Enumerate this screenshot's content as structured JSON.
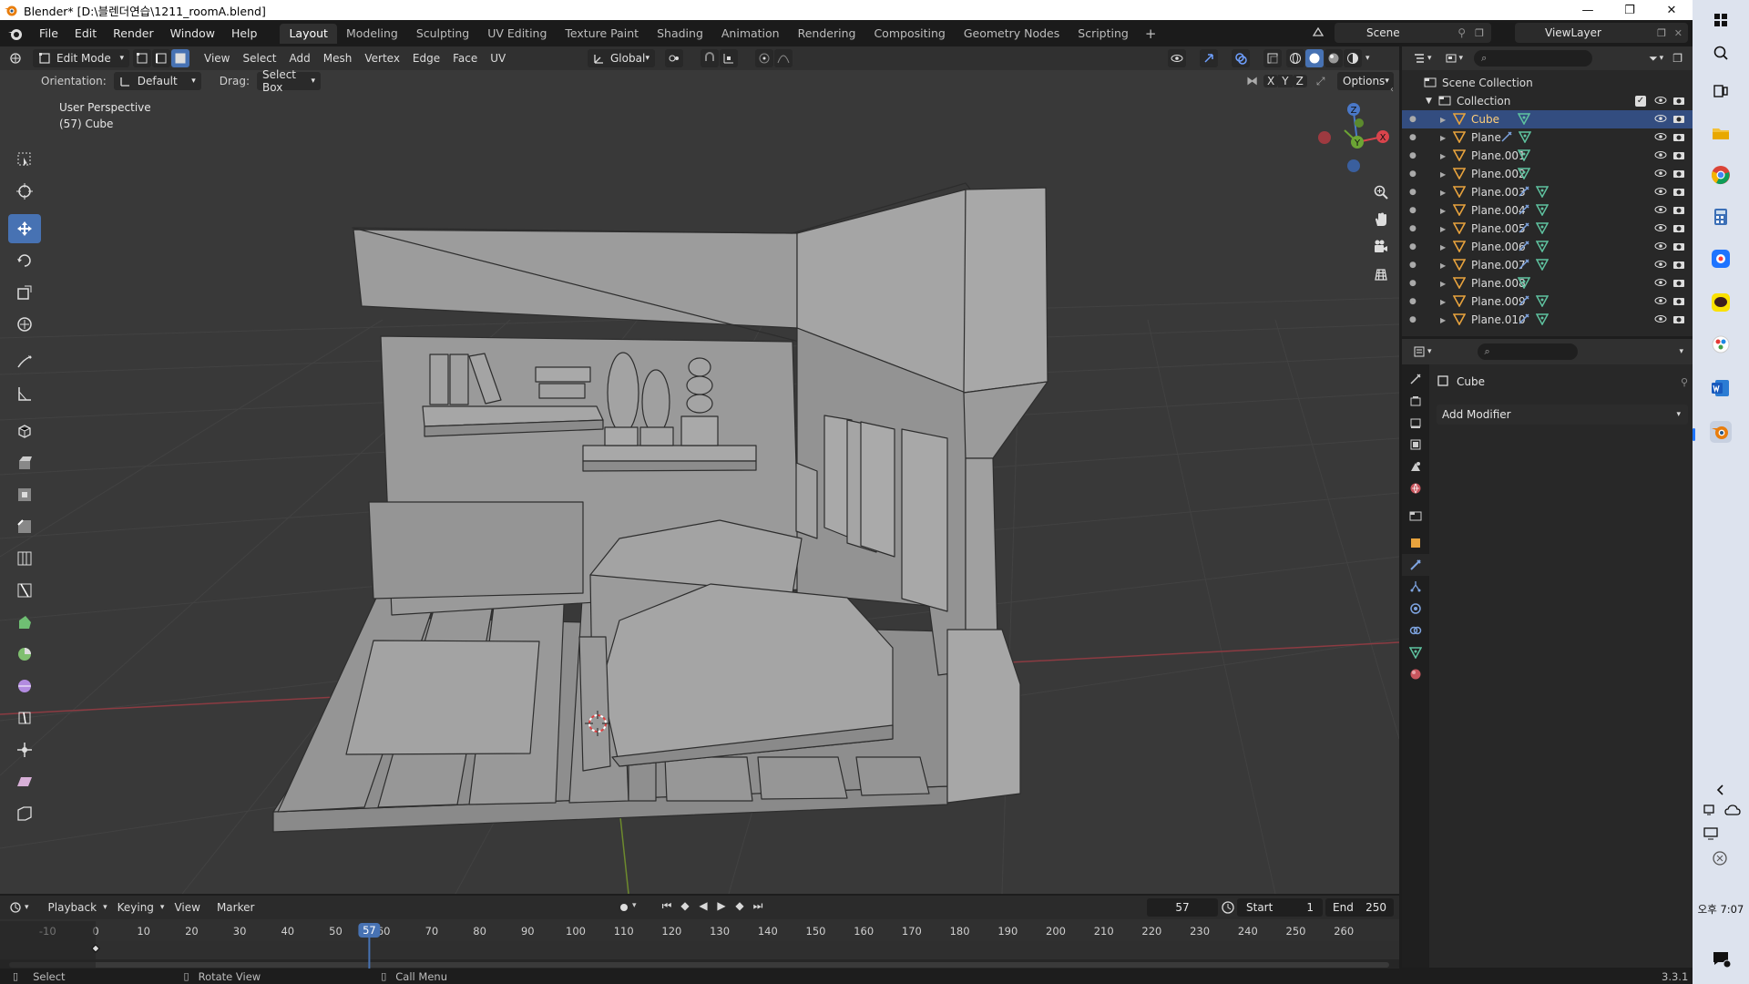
{
  "window": {
    "title": "Blender* [D:\\블렌더연습\\1211_roomA.blend]",
    "minimize": "—",
    "maximize": "❐",
    "close": "✕"
  },
  "menu": [
    "File",
    "Edit",
    "Render",
    "Window",
    "Help"
  ],
  "workspaces": [
    "Layout",
    "Modeling",
    "Sculpting",
    "UV Editing",
    "Texture Paint",
    "Shading",
    "Animation",
    "Rendering",
    "Compositing",
    "Geometry Nodes",
    "Scripting"
  ],
  "workspace_add": "+",
  "scene": {
    "name": "Scene",
    "view_layer": "ViewLayer"
  },
  "viewport": {
    "mode": "Edit Mode",
    "menus": [
      "View",
      "Select",
      "Add",
      "Mesh",
      "Vertex",
      "Edge",
      "Face",
      "UV"
    ],
    "transform_orientation": "Global",
    "orientation_label": "Orientation:",
    "orientation_value": "Default",
    "drag_label": "Drag:",
    "drag_value": "Select Box",
    "axes": [
      "X",
      "Y",
      "Z"
    ],
    "options": "Options",
    "info_line1": "User Perspective",
    "info_line2": "(57) Cube",
    "gizmo": {
      "x": "X",
      "y": "Y",
      "z": "Z"
    }
  },
  "timeline": {
    "menus": [
      "Playback",
      "Keying",
      "View",
      "Marker"
    ],
    "current_frame": "57",
    "start_label": "Start",
    "start": "1",
    "end_label": "End",
    "end": "250",
    "ticks": [
      "-10",
      "0",
      "10",
      "20",
      "30",
      "40",
      "50",
      "60",
      "70",
      "80",
      "90",
      "100",
      "110",
      "120",
      "130",
      "140",
      "150",
      "160",
      "170",
      "180",
      "190",
      "200",
      "210",
      "220",
      "230",
      "240",
      "250",
      "260"
    ],
    "playhead_label": "57"
  },
  "statusbar": {
    "select": "Select",
    "rotate": "Rotate View",
    "call_menu": "Call Menu",
    "version": "3.3.1"
  },
  "outliner": {
    "scene_collection": "Scene Collection",
    "collection": "Collection",
    "items": [
      {
        "name": "Cube",
        "selected": true,
        "modifier": false
      },
      {
        "name": "Plane",
        "selected": false,
        "modifier": true
      },
      {
        "name": "Plane.001",
        "selected": false,
        "modifier": false
      },
      {
        "name": "Plane.002",
        "selected": false,
        "modifier": false
      },
      {
        "name": "Plane.003",
        "selected": false,
        "modifier": true
      },
      {
        "name": "Plane.004",
        "selected": false,
        "modifier": true
      },
      {
        "name": "Plane.005",
        "selected": false,
        "modifier": true
      },
      {
        "name": "Plane.006",
        "selected": false,
        "modifier": true
      },
      {
        "name": "Plane.007",
        "selected": false,
        "modifier": true
      },
      {
        "name": "Plane.008",
        "selected": false,
        "modifier": false
      },
      {
        "name": "Plane.009",
        "selected": false,
        "modifier": true
      },
      {
        "name": "Plane.010",
        "selected": false,
        "modifier": true
      }
    ]
  },
  "properties": {
    "object_name": "Cube",
    "add_modifier": "Add Modifier"
  },
  "taskbar": {
    "time_line1": "오후 7:07"
  },
  "colors": {
    "accent": "#4772b3",
    "selected_row": "#334d80",
    "object_orange": "#e8a33d",
    "mesh_green": "#5fc3a0",
    "modifier_blue": "#7ea4e0"
  }
}
